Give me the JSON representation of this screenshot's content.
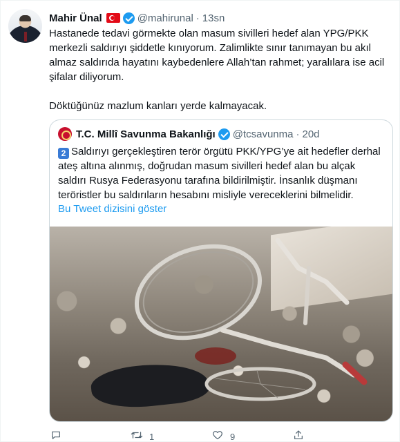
{
  "tweet": {
    "author_name": "Mahir Ünal",
    "handle": "@mahirunal",
    "separator": "·",
    "time": "13sn",
    "paragraphs": [
      "Hastanede tedavi görmekte olan masum sivilleri hedef alan YPG/PKK merkezli saldırıyı şiddetle kınıyorum. Zalimlikte sınır tanımayan bu akıl almaz saldırıda hayatını kaybedenlere Allah’tan rahmet; yaralılara ise acil şifalar diliyorum.",
      "Döktüğünüz mazlum kanları yerde kalmayacak."
    ]
  },
  "quoted": {
    "author_name": "T.C. Millî Savunma Bakanlığı",
    "handle": "@tcsavunma",
    "separator": "·",
    "time": "20d",
    "keycap": "2",
    "text": "Saldırıyı gerçekleştiren terör örgütü PKK/YPG’ye ait hedefler derhal ateş altına alınmış, doğrudan masum sivilleri hedef alan bu alçak saldırı Rusya Federasyonu tarafına bildirilmiştir. İnsanlık düşmanı teröristler bu saldırıların hesabını misliyle vereceklerini bilmelidir.",
    "show_thread": "Bu Tweet dizisini göster"
  },
  "actions": {
    "reply_icon": "reply-icon",
    "retweet_icon": "retweet-icon",
    "retweet_count": "1",
    "like_icon": "heart-icon",
    "like_count": "9",
    "share_icon": "share-icon"
  },
  "colors": {
    "accent": "#1d9bf0",
    "secondary_text": "#536471",
    "primary_text": "#0f1419",
    "border": "#cfd9de"
  }
}
